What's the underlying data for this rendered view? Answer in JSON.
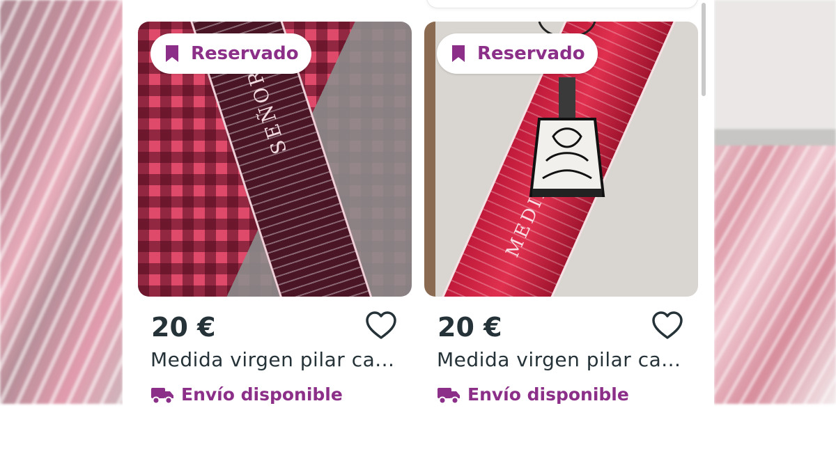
{
  "colors": {
    "accent_purple": "#8b2f88",
    "text_dark": "#253238",
    "surface": "#ffffff"
  },
  "listings": [
    {
      "badge": {
        "icon": "bookmark-icon",
        "label": "Reservado"
      },
      "price": "20 €",
      "title": "Medida virgen pilar ca...",
      "shipping": {
        "icon": "truck-icon",
        "label": "Envío disponible"
      },
      "favorite_icon": "heart-outline-icon",
      "image_text": "SEÑOR"
    },
    {
      "badge": {
        "icon": "bookmark-icon",
        "label": "Reservado"
      },
      "price": "20 €",
      "title": "Medida virgen pilar ca...",
      "shipping": {
        "icon": "truck-icon",
        "label": "Envío disponible"
      },
      "favorite_icon": "heart-outline-icon",
      "image_text": "MEDIDA"
    }
  ]
}
